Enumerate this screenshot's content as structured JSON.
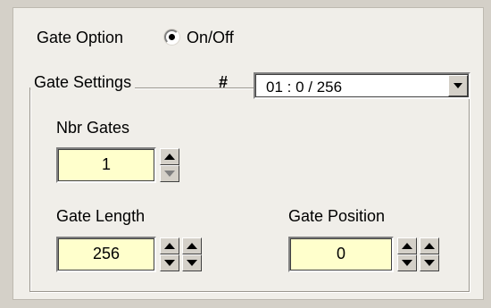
{
  "gate_option": {
    "label": "Gate Option",
    "radio_label": "On/Off",
    "selected": true
  },
  "gate_settings": {
    "group_label": "Gate Settings",
    "hash_label": "#",
    "selector_value": "01 : 0 / 256",
    "nbr_gates": {
      "label": "Nbr Gates",
      "value": "1"
    },
    "gate_length": {
      "label": "Gate Length",
      "value": "256"
    },
    "gate_position": {
      "label": "Gate Position",
      "value": "0"
    }
  },
  "icons": {
    "spin_up": "triangle-up-icon",
    "spin_down": "triangle-down-icon",
    "combo_arrow": "chevron-down-icon"
  },
  "colors": {
    "panel_bg": "#f0eee9",
    "window_bg": "#d4d0c8",
    "field_bg": "#ffffcc"
  }
}
